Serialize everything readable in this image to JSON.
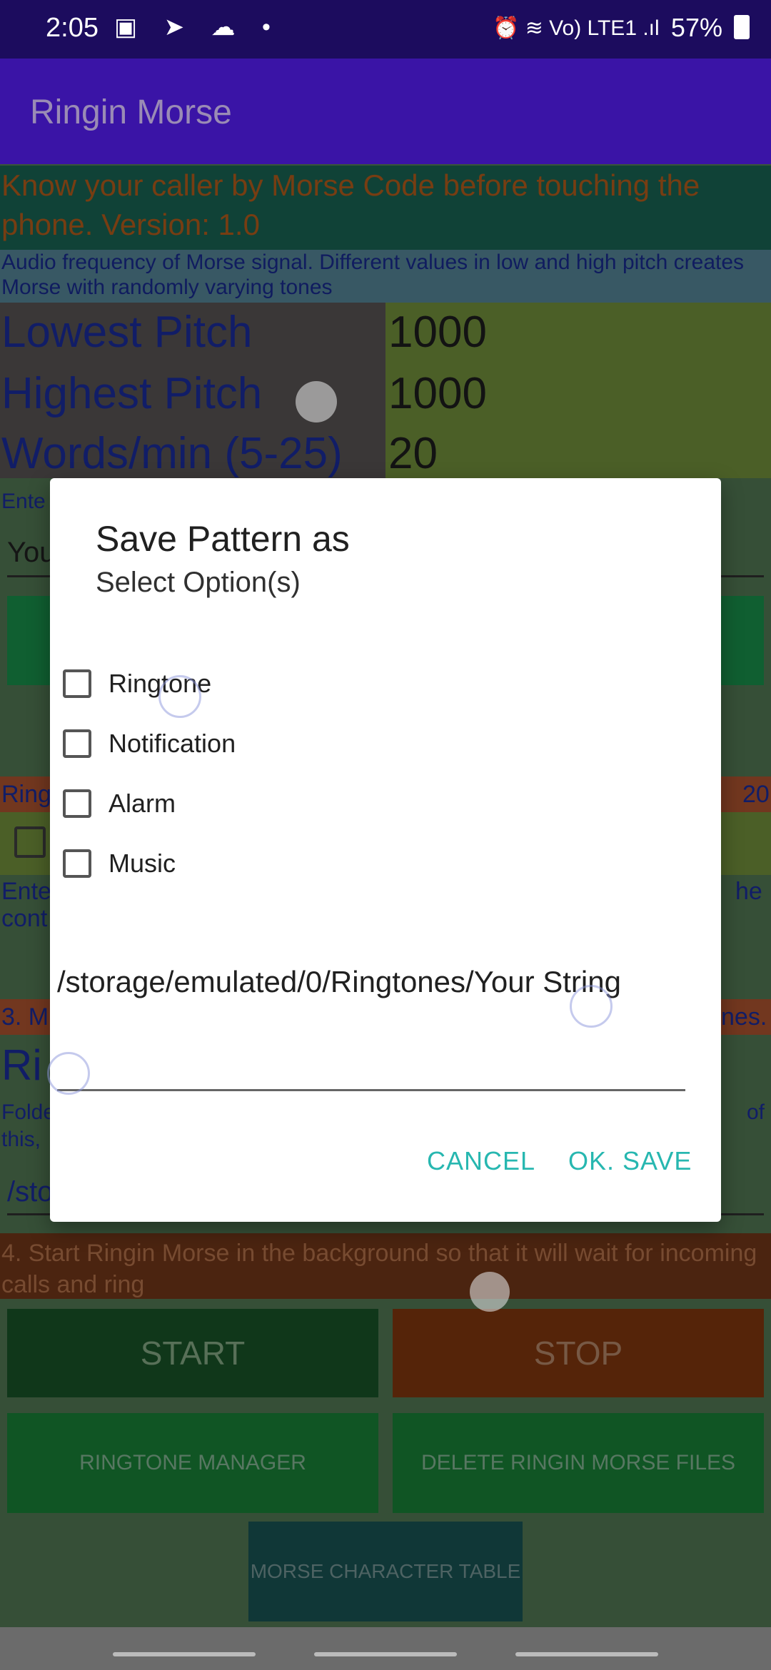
{
  "status": {
    "time": "2:05",
    "battery": "57%",
    "icons_left": "▣ ➤ ☁ •",
    "icons_right": "⏰ ≋ Vo) LTE1 .ıl"
  },
  "app": {
    "title": "Ringin Morse"
  },
  "main": {
    "intro": "Know your caller by Morse Code before touching the phone. Version: 1.0",
    "freq_help": "Audio frequency of Morse signal. Different values in low and high pitch creates Morse with randomly varying tones",
    "lowest_label": "Lowest Pitch",
    "lowest_value": "1000",
    "highest_label": "Highest Pitch",
    "highest_value": "1000",
    "wpm_label": "Words/min (5-25)",
    "wpm_value": "20",
    "enter_partial": "Ente",
    "your_partial": "You",
    "ring_partial": "Ring",
    "ring_right_partial": "20",
    "enter_partial2": "Ente",
    "cont_partial": "cont",
    "he_partial": "he",
    "section3_partial": "3. M",
    "section3_right": "nes.",
    "rin_partial": "Ri",
    "folder_partial": "Folde",
    "this_partial": "this,",
    "of_partial": "of",
    "sto_partial": "/sto",
    "section4": "4. Start Ringin Morse in the background so that it will wait for incoming calls and ring",
    "start": "START",
    "stop": "STOP",
    "ringtone_manager": "RINGTONE MANAGER",
    "delete_files": "DELETE RINGIN MORSE FILES",
    "morse_table": "MORSE CHARACTER TABLE"
  },
  "dialog": {
    "title": "Save Pattern as",
    "subtitle": "Select Option(s)",
    "options": [
      "Ringtone",
      "Notification",
      "Alarm",
      "Music"
    ],
    "path": "/storage/emulated/0/Ringtones/Your String",
    "cancel": "CANCEL",
    "ok": "OK. SAVE"
  }
}
